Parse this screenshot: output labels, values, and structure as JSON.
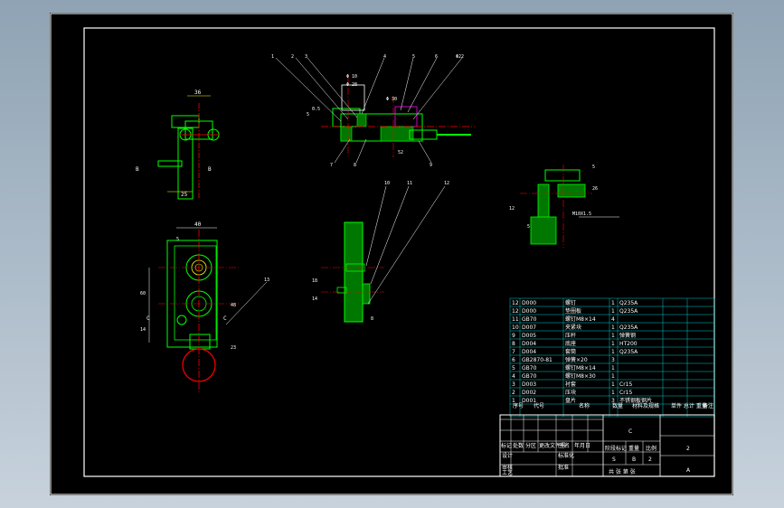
{
  "drawing": {
    "top_view_labels": [
      "1",
      "2",
      "3",
      "4",
      "5",
      "6",
      "Φ22",
      "7",
      "8",
      "9"
    ],
    "top_view_dims": [
      "Φ 10",
      "Φ 28",
      "Φ 30",
      "5",
      "0.5",
      "52"
    ],
    "left_view_dims": [
      "36",
      "25",
      "8",
      "8"
    ],
    "front_view_dims": [
      "40",
      "5",
      "60",
      "14",
      "13",
      "48",
      "23"
    ],
    "section_view_labels": [
      "10",
      "11",
      "12",
      "8"
    ],
    "section_view_dims": [
      "18",
      "14"
    ],
    "detail_view_dims": [
      "5",
      "26",
      "M10X1.5",
      "12",
      "5"
    ],
    "cut_marks": [
      "B",
      "B",
      "C",
      "C"
    ]
  },
  "bom": {
    "rows": [
      {
        "no": "12",
        "code": "D000",
        "name": "螺钉",
        "qty": "1",
        "material": "Q235A"
      },
      {
        "no": "12",
        "code": "D000",
        "name": "垫圈板",
        "qty": "1",
        "material": "Q235A"
      },
      {
        "no": "11",
        "code": "GB70",
        "name": "螺钉M8×14",
        "qty": "4",
        "material": ""
      },
      {
        "no": "10",
        "code": "D007",
        "name": "夹紧块",
        "qty": "1",
        "material": "Q235A"
      },
      {
        "no": "9",
        "code": "D005",
        "name": "压杆",
        "qty": "1",
        "material": "弹簧钢"
      },
      {
        "no": "8",
        "code": "D004",
        "name": "底座",
        "qty": "1",
        "material": "HT200"
      },
      {
        "no": "7",
        "code": "D004",
        "name": "套筒",
        "qty": "1",
        "material": "Q235A"
      },
      {
        "no": "6",
        "code": "GB2870-81",
        "name": "弹簧×20",
        "qty": "3",
        "material": ""
      },
      {
        "no": "5",
        "code": "GB70",
        "name": "螺钉M8×14",
        "qty": "1",
        "material": ""
      },
      {
        "no": "4",
        "code": "GB70",
        "name": "螺钉M8×30",
        "qty": "1",
        "material": ""
      },
      {
        "no": "3",
        "code": "D003",
        "name": "衬套",
        "qty": "1",
        "material": "Cr15"
      },
      {
        "no": "2",
        "code": "D002",
        "name": "压块",
        "qty": "1",
        "material": "Cr15"
      },
      {
        "no": "1",
        "code": "D001",
        "name": "盘片",
        "qty": "3",
        "material": "不锈钢板钢片"
      }
    ],
    "header": [
      "序号",
      "代号",
      "名称",
      "数量",
      "材料及规格",
      "单件 总计 重量",
      "备注"
    ],
    "title_block": {
      "drawing_title": "C",
      "mark_right_top": "2",
      "mark_right_bottom": "A",
      "stage_label": "阶段标记",
      "weight_label": "重量",
      "scale_label": "比例",
      "sheet_text": "共 张 第 张",
      "row_labels": [
        "标记",
        "处数",
        "分区",
        "更改文件号",
        "签名",
        "年月日"
      ],
      "sign_labels": [
        "设计",
        "审核",
        "工艺",
        "标准化",
        "批准"
      ],
      "scale_cells": [
        "S",
        "B",
        "2"
      ]
    }
  }
}
